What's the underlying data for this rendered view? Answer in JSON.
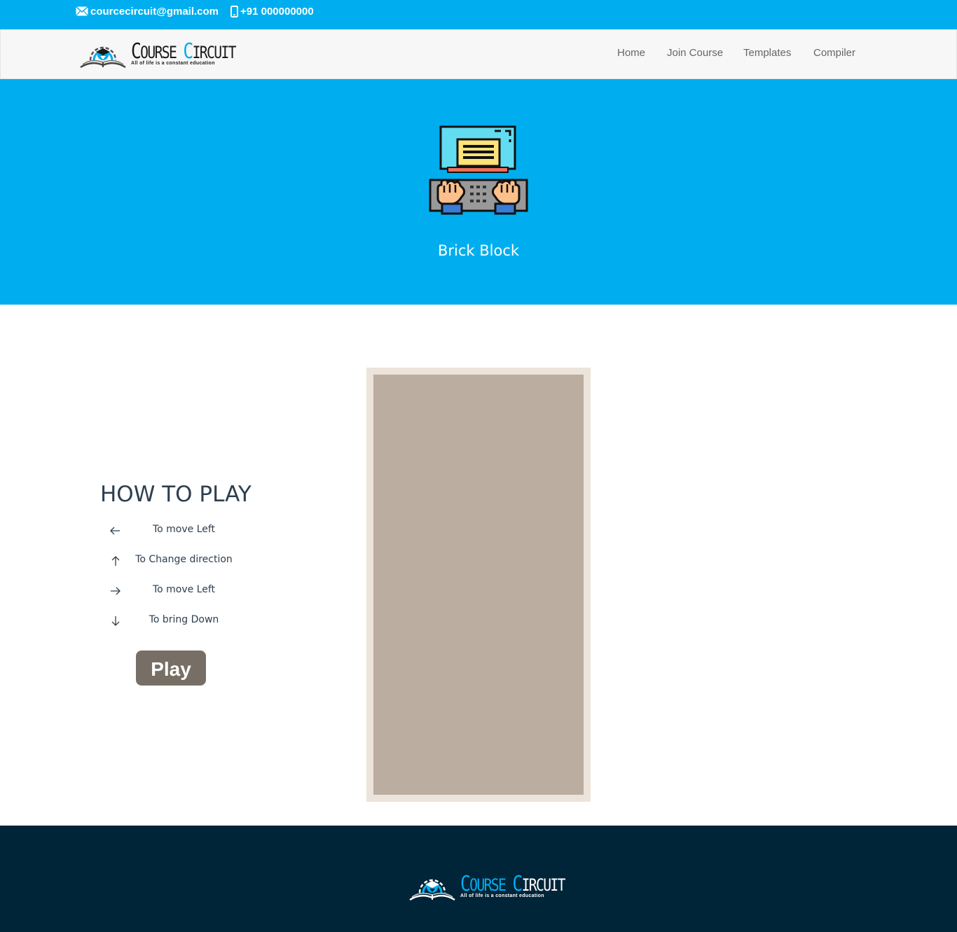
{
  "topbar": {
    "email": "courcecircuit@gmail.com",
    "phone": "+91 000000000",
    "email_icon": "envelope-icon",
    "phone_icon": "mobile-phone-icon"
  },
  "brand": {
    "name_first_cap": "C",
    "name_first_rest": "OURSE",
    "name_second_cap": "C",
    "name_second_rest": "IRCUIT",
    "tagline": "All of life is a constant education",
    "logo_icon": "open-book-graduation-cap-logo"
  },
  "nav": {
    "links": [
      "Home",
      "Join Course",
      "Templates",
      "Compiler"
    ]
  },
  "hero": {
    "title": "Brick Block",
    "icon": "computer-typing-hands-icon"
  },
  "how_to_play": {
    "title": "HOW TO PLAY",
    "controls": [
      {
        "icon": "arrow-left-icon",
        "text": "To move Left"
      },
      {
        "icon": "arrow-up-icon",
        "text": "To Change direction"
      },
      {
        "icon": "arrow-right-icon",
        "text": "To move Left"
      },
      {
        "icon": "arrow-down-icon",
        "text": "To bring Down"
      }
    ],
    "play_label": "Play"
  },
  "colors": {
    "accent": "#00aeef",
    "footer_bg": "#002438",
    "board_frame": "#ece3da",
    "board": "#bbada0",
    "play_button": "#776e65"
  }
}
